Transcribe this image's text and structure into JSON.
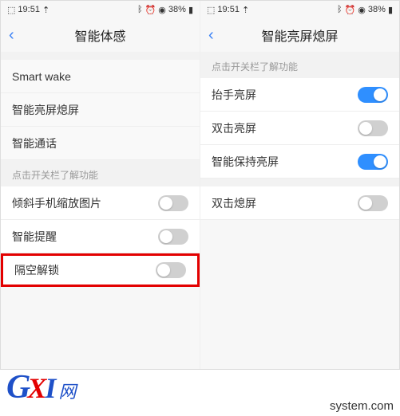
{
  "status": {
    "time": "19:51",
    "battery_pct": "38%",
    "upload_icon": "↥",
    "bt_icon": "⚪",
    "alarm_icon": "⏰",
    "wifi_icon": "📶",
    "batt_icon": "🔋"
  },
  "left": {
    "title": "智能体感",
    "nav_items": [
      "Smart wake",
      "智能亮屏熄屏",
      "智能通话"
    ],
    "section_header": "点击开关栏了解功能",
    "toggles": [
      {
        "label": "倾斜手机缩放图片",
        "on": false
      },
      {
        "label": "智能提醒",
        "on": false
      },
      {
        "label": "隔空解锁",
        "on": false,
        "highlight": true
      }
    ]
  },
  "right": {
    "title": "智能亮屏熄屏",
    "section_header": "点击开关栏了解功能",
    "group1": [
      {
        "label": "抬手亮屏",
        "on": true
      },
      {
        "label": "双击亮屏",
        "on": false
      },
      {
        "label": "智能保持亮屏",
        "on": true
      }
    ],
    "group2": [
      {
        "label": "双击熄屏",
        "on": false
      }
    ]
  },
  "watermark": {
    "logo_g": "G",
    "logo_x": "X",
    "logo_i": "I",
    "logo_net": "网",
    "url": "system.com"
  }
}
